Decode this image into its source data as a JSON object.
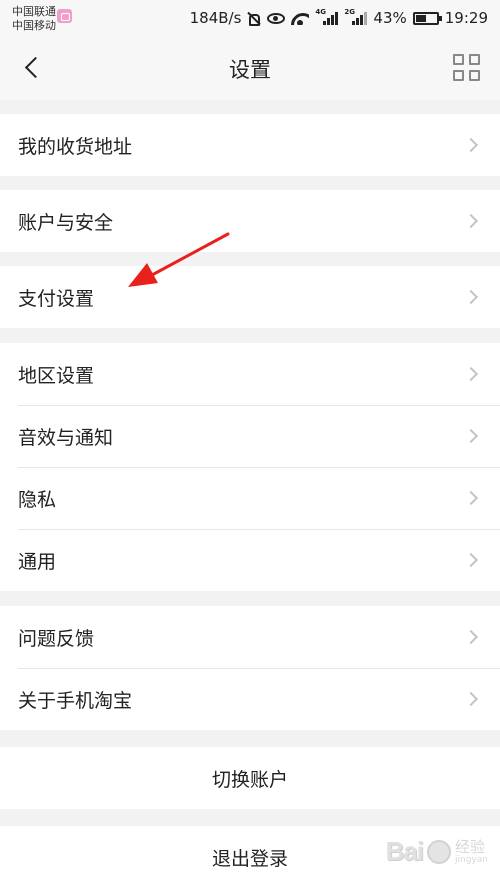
{
  "status_bar": {
    "carrier_1": "中国联通",
    "carrier_2": "中国移动",
    "speed": "184B/s",
    "network_1": "4G",
    "network_2": "2G",
    "battery": "43%",
    "time": "19:29"
  },
  "nav": {
    "title": "设置",
    "back_icon": "chevron-left-icon",
    "grid_icon": "qr-grid-icon"
  },
  "groups": [
    {
      "items": [
        {
          "label": "我的收货地址"
        }
      ]
    },
    {
      "items": [
        {
          "label": "账户与安全"
        }
      ]
    },
    {
      "items": [
        {
          "label": "支付设置"
        }
      ]
    },
    {
      "items": [
        {
          "label": "地区设置"
        },
        {
          "label": "音效与通知"
        },
        {
          "label": "隐私"
        },
        {
          "label": "通用"
        }
      ]
    },
    {
      "items": [
        {
          "label": "问题反馈"
        },
        {
          "label": "关于手机淘宝"
        }
      ]
    }
  ],
  "actions": {
    "switch_account": "切换账户",
    "logout": "退出登录"
  },
  "annotation": {
    "arrow_color": "#e8211c"
  },
  "watermark": {
    "logo": "Bai",
    "text_1": "经验",
    "text_2": "jingyan"
  }
}
